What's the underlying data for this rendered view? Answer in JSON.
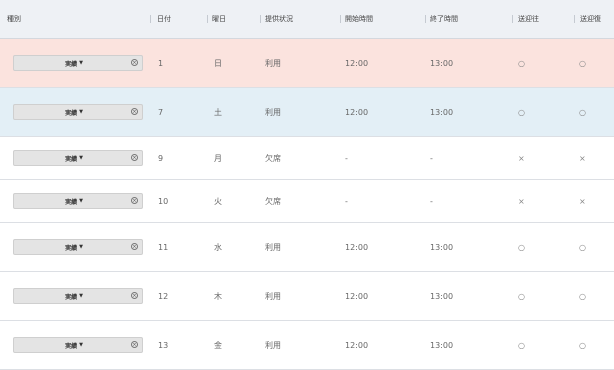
{
  "headers": {
    "type": "種別",
    "date": "日付",
    "weekday": "曜日",
    "status": "提供状況",
    "start": "開始時間",
    "end": "終了時間",
    "pickup": "送迎往",
    "dropoff": "送迎復"
  },
  "rows": [
    {
      "type": "実績",
      "date": "1",
      "weekday": "日",
      "status": "利用",
      "start": "12:00",
      "end": "13:00",
      "pickup": "○",
      "dropoff": "○",
      "kind": "holiday"
    },
    {
      "type": "実績",
      "date": "7",
      "weekday": "土",
      "status": "利用",
      "start": "12:00",
      "end": "13:00",
      "pickup": "○",
      "dropoff": "○",
      "kind": "saturday"
    },
    {
      "type": "実績",
      "date": "9",
      "weekday": "月",
      "status": "欠席",
      "start": "-",
      "end": "-",
      "pickup": "×",
      "dropoff": "×",
      "kind": "normal"
    },
    {
      "type": "実績",
      "date": "10",
      "weekday": "火",
      "status": "欠席",
      "start": "-",
      "end": "-",
      "pickup": "×",
      "dropoff": "×",
      "kind": "normal"
    },
    {
      "type": "実績",
      "date": "11",
      "weekday": "水",
      "status": "利用",
      "start": "12:00",
      "end": "13:00",
      "pickup": "○",
      "dropoff": "○",
      "kind": "normal"
    },
    {
      "type": "実績",
      "date": "12",
      "weekday": "木",
      "status": "利用",
      "start": "12:00",
      "end": "13:00",
      "pickup": "○",
      "dropoff": "○",
      "kind": "normal"
    },
    {
      "type": "実績",
      "date": "13",
      "weekday": "金",
      "status": "利用",
      "start": "12:00",
      "end": "13:00",
      "pickup": "○",
      "dropoff": "○",
      "kind": "normal"
    }
  ],
  "colors": {
    "holiday_row": "#fbe3de",
    "saturday_row": "#e3eff6",
    "header_bg": "#eef1f5"
  },
  "icons": {
    "dropdown": "chevron-down-icon",
    "clear": "clear-icon"
  }
}
